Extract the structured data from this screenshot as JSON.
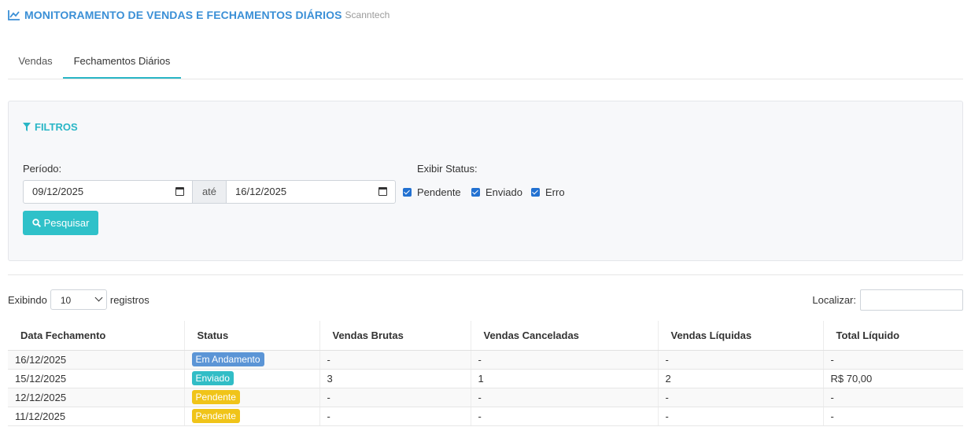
{
  "header": {
    "title": "MONITORAMENTO DE VENDAS E FECHAMENTOS DIÁRIOS",
    "subtitle": "Scanntech",
    "icon": "line-chart-icon"
  },
  "tabs": [
    {
      "label": "Vendas",
      "active": false
    },
    {
      "label": "Fechamentos Diários",
      "active": true
    }
  ],
  "filters": {
    "title": "FILTROS",
    "periodo_label": "Período:",
    "date_from": "09/12/2025",
    "ate_label": "até",
    "date_to": "16/12/2025",
    "status_label": "Exibir Status:",
    "status_options": [
      {
        "label": "Pendente",
        "checked": true
      },
      {
        "label": "Enviado",
        "checked": true
      },
      {
        "label": "Erro",
        "checked": true
      }
    ],
    "search_button": "Pesquisar"
  },
  "table_controls": {
    "length_prefix": "Exibindo",
    "length_value": "10",
    "length_suffix": "registros",
    "search_label": "Localizar:",
    "search_value": ""
  },
  "table": {
    "columns": [
      "Data Fechamento",
      "Status",
      "Vendas Brutas",
      "Vendas Canceladas",
      "Vendas Líquidas",
      "Total Líquido"
    ],
    "rows": [
      {
        "data": "16/12/2025",
        "status": "Em Andamento",
        "brutas": "-",
        "canceladas": "-",
        "liquidas": "-",
        "total": "-"
      },
      {
        "data": "15/12/2025",
        "status": "Enviado",
        "brutas": "3",
        "canceladas": "1",
        "liquidas": "2",
        "total": "R$ 70,00"
      },
      {
        "data": "12/12/2025",
        "status": "Pendente",
        "brutas": "-",
        "canceladas": "-",
        "liquidas": "-",
        "total": "-"
      },
      {
        "data": "11/12/2025",
        "status": "Pendente",
        "brutas": "-",
        "canceladas": "-",
        "liquidas": "-",
        "total": "-"
      }
    ]
  },
  "colors": {
    "accent": "#3a8fd6",
    "teal": "#29b6c6",
    "badge_em_andamento": "#5b95d6",
    "badge_enviado": "#31bdc6",
    "badge_pendente": "#f0c419"
  }
}
